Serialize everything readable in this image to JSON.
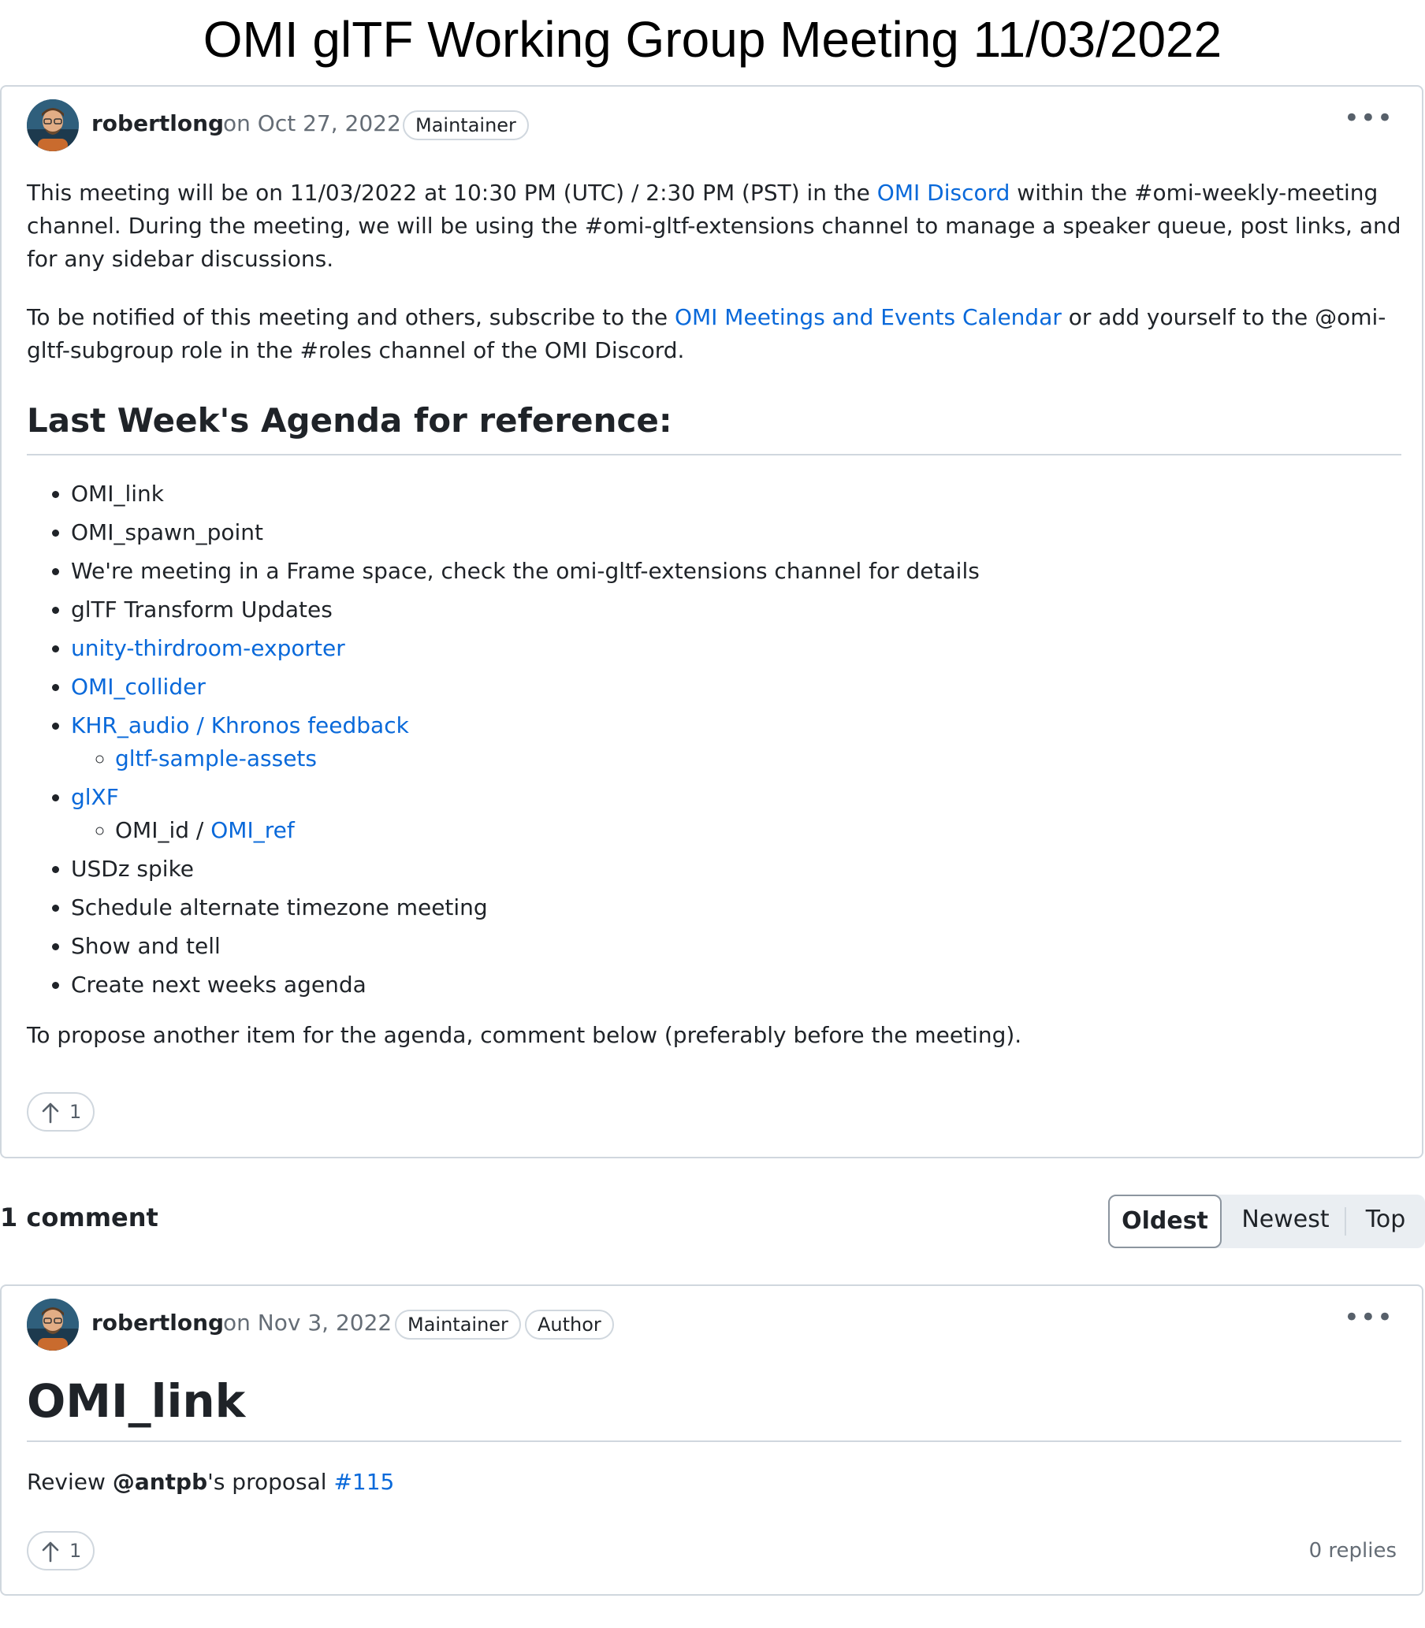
{
  "page": {
    "title": "OMI glTF Working Group Meeting 11/03/2022"
  },
  "post": {
    "author": "robertlong",
    "date": "on Oct 27, 2022",
    "badges": [
      "Maintainer"
    ],
    "menu_icon": "kebab-horizontal-icon",
    "para1": {
      "before": "This meeting will be on 11/03/2022 at 10:30 PM (UTC) / 2:30 PM (PST) in the ",
      "link": "OMI Discord",
      "after": " within the #omi-weekly-meeting channel. During the meeting, we will be using the #omi-gltf-extensions channel to manage a speaker queue, post links, and for any sidebar discussions."
    },
    "para2": {
      "before": "To be notified of this meeting and others, subscribe to the ",
      "link": "OMI Meetings and Events Calendar",
      "after": " or add yourself to the @omi-gltf-subgroup role in the #roles channel of the OMI Discord."
    },
    "heading": "Last Week's Agenda for reference:",
    "agenda": {
      "item1": "OMI_link",
      "item2": "OMI_spawn_point",
      "item3": "We're meeting in a Frame space, check the omi-gltf-extensions channel for details",
      "item4": "glTF Transform Updates",
      "item5": "unity-thirdroom-exporter",
      "item6": "OMI_collider",
      "item7": "KHR_audio / Khronos feedback",
      "item7_sub1": "gltf-sample-assets",
      "item8": "glXF",
      "item8_sub1_text": "OMI_id / ",
      "item8_sub1_link": "OMI_ref",
      "item9": "USDz spike",
      "item10": "Schedule alternate timezone meeting",
      "item11": "Show and tell",
      "item12": "Create next weeks agenda"
    },
    "footer_text": "To propose another item for the agenda, comment below (preferably before the meeting).",
    "upvotes": "1",
    "upvote_icon": "arrow-up-icon"
  },
  "comments": {
    "count_label": "1 comment",
    "sort": {
      "oldest": "Oldest",
      "newest": "Newest",
      "top": "Top",
      "selected": "Oldest"
    }
  },
  "comment": {
    "author": "robertlong",
    "date": "on Nov 3, 2022",
    "badge1": "Maintainer",
    "badge2": "Author",
    "heading": "OMI_link",
    "text_before": "Review ",
    "mention": "@antpb",
    "text_middle": "'s proposal ",
    "issue_link": "#115",
    "upvotes": "1",
    "replies": "0 replies"
  }
}
